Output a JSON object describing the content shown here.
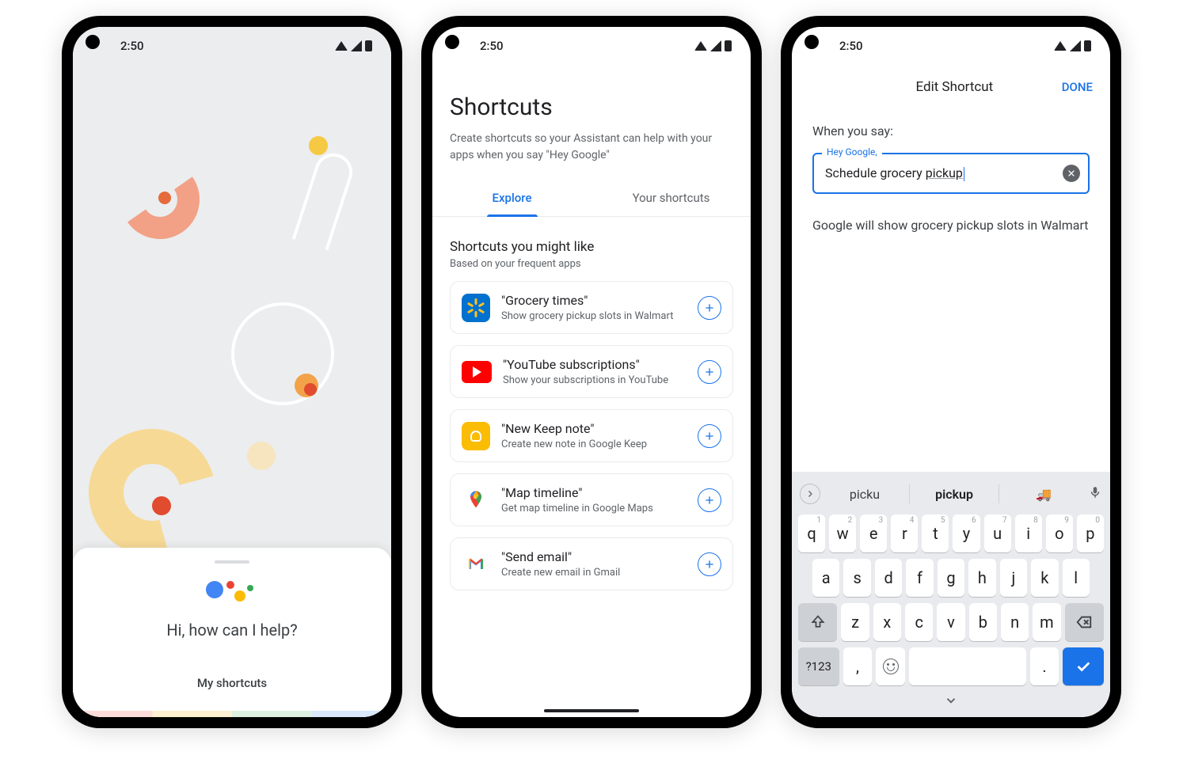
{
  "status": {
    "time": "2:50"
  },
  "phone1": {
    "greeting": "Hi, how can I help?",
    "shortcuts_button": "My shortcuts"
  },
  "phone2": {
    "title": "Shortcuts",
    "subtitle": "Create shortcuts so your Assistant can help with your apps when you say \"Hey Google\"",
    "tabs": {
      "explore": "Explore",
      "yours": "Your shortcuts"
    },
    "section_heading": "Shortcuts you might like",
    "section_sub": "Based on your frequent apps",
    "items": [
      {
        "title": "\"Grocery times\"",
        "sub": "Show grocery pickup slots in Walmart",
        "icon": "walmart"
      },
      {
        "title": "\"YouTube subscriptions\"",
        "sub": "Show your subscriptions in YouTube",
        "icon": "youtube"
      },
      {
        "title": "\"New Keep note\"",
        "sub": "Create new note in Google Keep",
        "icon": "keep"
      },
      {
        "title": "\"Map timeline\"",
        "sub": "Get map timeline in Google Maps",
        "icon": "maps"
      },
      {
        "title": "\"Send email\"",
        "sub": "Create new email in Gmail",
        "icon": "gmail"
      }
    ]
  },
  "phone3": {
    "header_title": "Edit Shortcut",
    "done": "DONE",
    "when_label": "When you say:",
    "field_legend": "Hey Google,",
    "field_value_prefix": "Schedule grocery ",
    "field_value_underlined": "pickup",
    "result_text": "Google will show grocery pickup slots in Walmart",
    "suggestions": {
      "s1": "picku",
      "s2": "pickup",
      "emoji": "🚚"
    },
    "keys": {
      "row1": [
        "q",
        "w",
        "e",
        "r",
        "t",
        "y",
        "u",
        "i",
        "o",
        "p"
      ],
      "row1_hints": [
        "1",
        "2",
        "3",
        "4",
        "5",
        "6",
        "7",
        "8",
        "9",
        "0"
      ],
      "row2": [
        "a",
        "s",
        "d",
        "f",
        "g",
        "h",
        "j",
        "k",
        "l"
      ],
      "row3": [
        "z",
        "x",
        "c",
        "v",
        "b",
        "n",
        "m"
      ],
      "symbols": "?123",
      "comma": ",",
      "period": "."
    }
  }
}
